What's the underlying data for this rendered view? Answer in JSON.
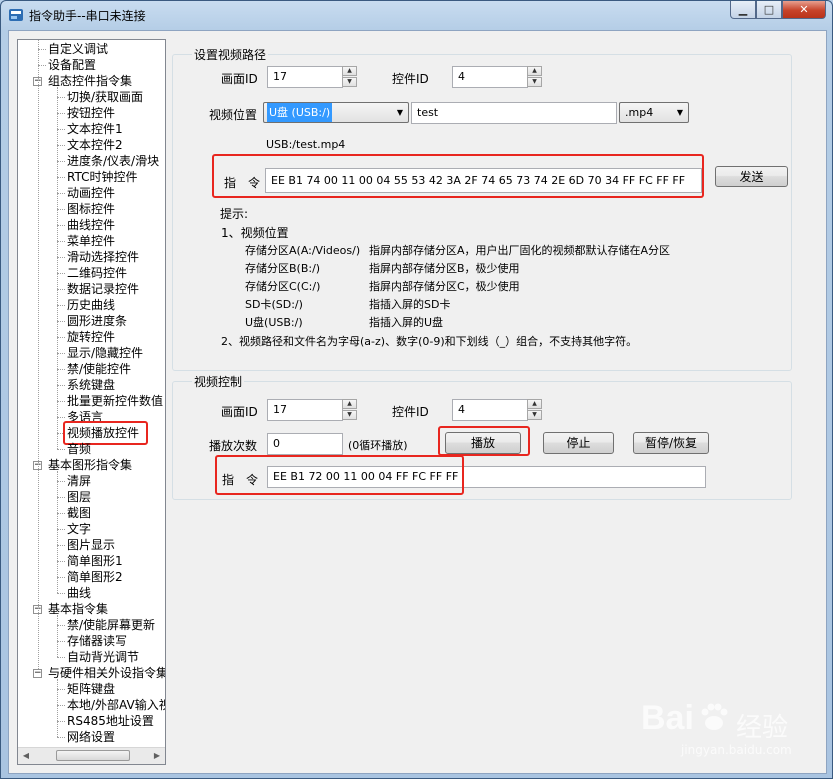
{
  "window": {
    "title": "指令助手--串口未连接"
  },
  "tree": {
    "items": [
      {
        "label": "自定义调试",
        "level": 1,
        "expander": ""
      },
      {
        "label": "设备配置",
        "level": 1,
        "expander": ""
      },
      {
        "label": "组态控件指令集",
        "level": 1,
        "expander": "−"
      },
      {
        "label": "切换/获取画面",
        "level": 2
      },
      {
        "label": "按钮控件",
        "level": 2
      },
      {
        "label": "文本控件1",
        "level": 2
      },
      {
        "label": "文本控件2",
        "level": 2
      },
      {
        "label": "进度条/仪表/滑块",
        "level": 2
      },
      {
        "label": "RTC时钟控件",
        "level": 2
      },
      {
        "label": "动画控件",
        "level": 2
      },
      {
        "label": "图标控件",
        "level": 2
      },
      {
        "label": "曲线控件",
        "level": 2
      },
      {
        "label": "菜单控件",
        "level": 2
      },
      {
        "label": "滑动选择控件",
        "level": 2
      },
      {
        "label": "二维码控件",
        "level": 2
      },
      {
        "label": "数据记录控件",
        "level": 2
      },
      {
        "label": "历史曲线",
        "level": 2
      },
      {
        "label": "圆形进度条",
        "level": 2
      },
      {
        "label": "旋转控件",
        "level": 2
      },
      {
        "label": "显示/隐藏控件",
        "level": 2
      },
      {
        "label": "禁/使能控件",
        "level": 2
      },
      {
        "label": "系统键盘",
        "level": 2
      },
      {
        "label": "批量更新控件数值",
        "level": 2
      },
      {
        "label": "多语言",
        "level": 2
      },
      {
        "label": "视频播放控件",
        "level": 2,
        "selected": true
      },
      {
        "label": "音频",
        "level": 2
      },
      {
        "label": "基本图形指令集",
        "level": 1,
        "expander": "−"
      },
      {
        "label": "清屏",
        "level": 2
      },
      {
        "label": "图层",
        "level": 2
      },
      {
        "label": "截图",
        "level": 2
      },
      {
        "label": "文字",
        "level": 2
      },
      {
        "label": "图片显示",
        "level": 2
      },
      {
        "label": "简单图形1",
        "level": 2
      },
      {
        "label": "简单图形2",
        "level": 2
      },
      {
        "label": "曲线",
        "level": 2
      },
      {
        "label": "基本指令集",
        "level": 1,
        "expander": "−"
      },
      {
        "label": "禁/使能屏幕更新",
        "level": 2
      },
      {
        "label": "存储器读写",
        "level": 2
      },
      {
        "label": "自动背光调节",
        "level": 2
      },
      {
        "label": "与硬件相关外设指令集",
        "level": 1,
        "expander": "−"
      },
      {
        "label": "矩阵键盘",
        "level": 2
      },
      {
        "label": "本地/外部AV输入视频",
        "level": 2
      },
      {
        "label": "RS485地址设置",
        "level": 2
      },
      {
        "label": "网络设置",
        "level": 2
      }
    ]
  },
  "path_group": {
    "title": "设置视频路径",
    "screen_id_label": "画面ID",
    "screen_id_value": "17",
    "control_id_label": "控件ID",
    "control_id_value": "4",
    "location_label": "视频位置",
    "location_selected": "U盘 (USB:/)",
    "filename_value": "test",
    "ext_selected": ".mp4",
    "full_path": "USB:/test.mp4",
    "cmd_label": "指　令",
    "cmd_value": "EE B1 74 00 11 00 04 55 53 42 3A 2F 74 65 73 74 2E 6D 70 34 FF FC FF FF",
    "send_label": "发送"
  },
  "hints": {
    "title": "提示:",
    "item1": "1、视频位置",
    "rows": [
      {
        "code": "存储分区A(A:/Videos/)",
        "desc": "指屏内部存储分区A，用户出厂固化的视频都默认存储在A分区"
      },
      {
        "code": "存储分区B(B:/)",
        "desc": "指屏内部存储分区B，极少使用"
      },
      {
        "code": "存储分区C(C:/)",
        "desc": "指屏内部存储分区C，极少使用"
      },
      {
        "code": "SD卡(SD:/)",
        "desc": "指插入屏的SD卡"
      },
      {
        "code": "U盘(USB:/)",
        "desc": "指插入屏的U盘"
      }
    ],
    "item2": "2、视频路径和文件名为字母(a-z)、数字(0-9)和下划线（_）组合，不支持其他字符。"
  },
  "control_group": {
    "title": "视频控制",
    "screen_id_label": "画面ID",
    "screen_id_value": "17",
    "control_id_label": "控件ID",
    "control_id_value": "4",
    "count_label": "播放次数",
    "count_value": "0",
    "count_note": "(0循环播放)",
    "play_label": "播放",
    "stop_label": "停止",
    "pause_label": "暂停/恢复",
    "cmd_label": "指　令",
    "cmd_value": "EE B1 72 00 11 00 04 FF FC FF FF"
  },
  "watermark": {
    "brand": "Bai",
    "brand2": "经验",
    "url": "jingyan.baidu.com"
  },
  "colors": {
    "highlight": "#e8261f",
    "selection": "#3399ff"
  },
  "icons": [
    "app-icon",
    "minimize-icon",
    "maximize-icon",
    "close-icon",
    "expander-icon",
    "spin-up-icon",
    "spin-down-icon",
    "dropdown-arrow-icon",
    "scroll-left-icon",
    "scroll-right-icon",
    "paw-icon"
  ]
}
